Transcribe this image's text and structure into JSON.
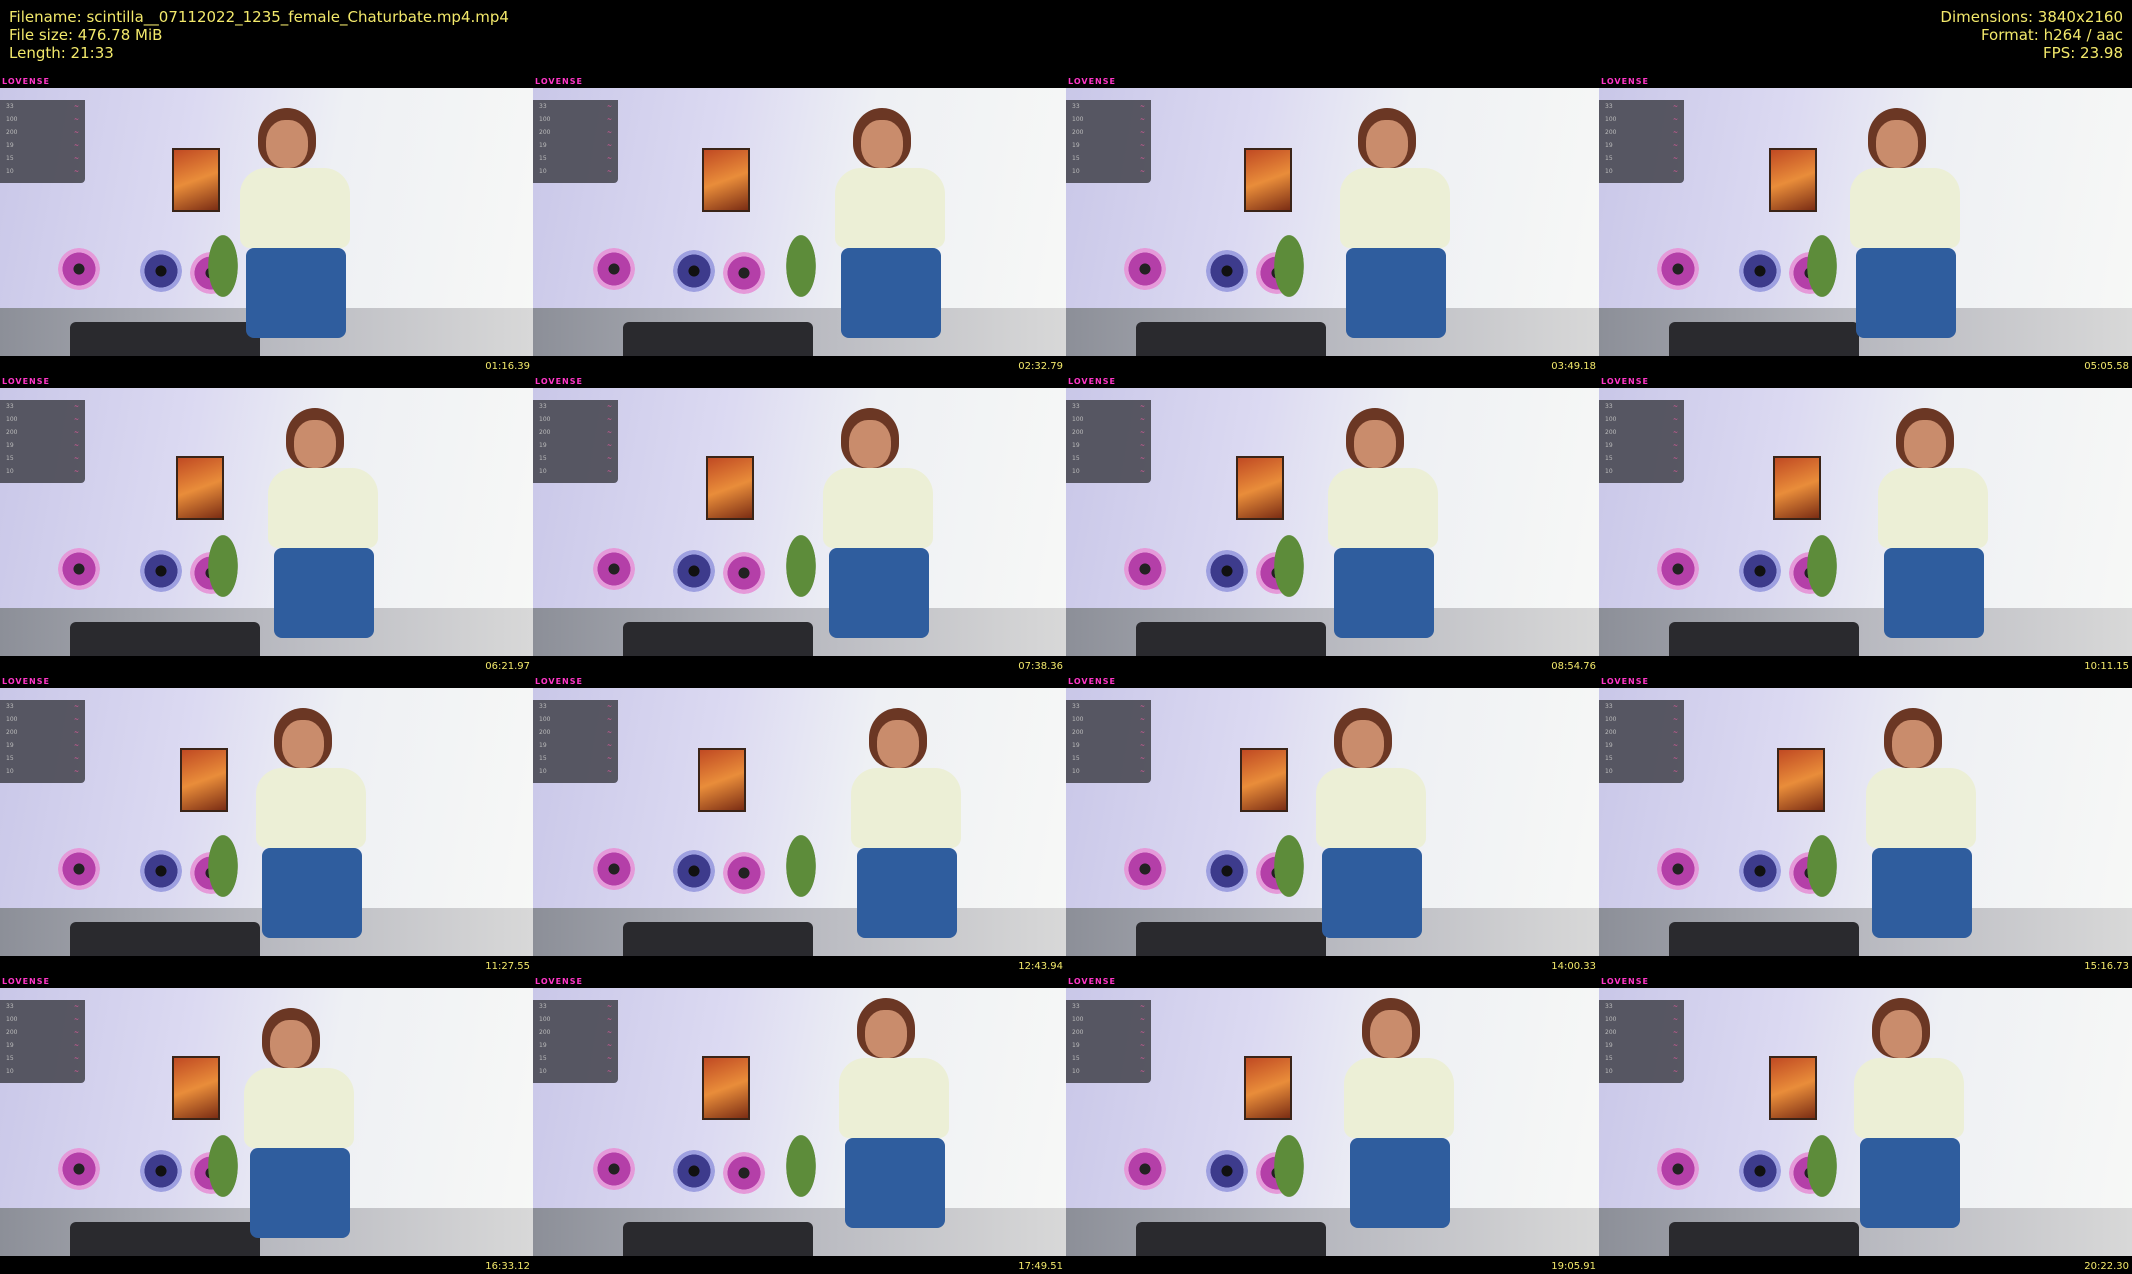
{
  "header": {
    "filename": "Filename: scintilla__07112022_1235_female_Chaturbate.mp4.mp4",
    "filesize": "File size: 476.78 MiB",
    "length": "Length: 21:33",
    "dimensions": "Dimensions: 3840x2160",
    "format": "Format: h264 / aac",
    "fps": "FPS: 23.98"
  },
  "overlay_label": "LOVENSE",
  "panel_rows": [
    "33",
    "100",
    "200",
    "19",
    "15",
    "10"
  ],
  "thumbnails": [
    {
      "timestamp": "01:16.39"
    },
    {
      "timestamp": "02:32.79"
    },
    {
      "timestamp": "03:49.18"
    },
    {
      "timestamp": "05:05.58"
    },
    {
      "timestamp": "06:21.97"
    },
    {
      "timestamp": "07:38.36"
    },
    {
      "timestamp": "08:54.76"
    },
    {
      "timestamp": "10:11.15"
    },
    {
      "timestamp": "11:27.55"
    },
    {
      "timestamp": "12:43.94"
    },
    {
      "timestamp": "14:00.33"
    },
    {
      "timestamp": "15:16.73"
    },
    {
      "timestamp": "16:33.12"
    },
    {
      "timestamp": "17:49.51"
    },
    {
      "timestamp": "19:05.91"
    },
    {
      "timestamp": "20:22.30"
    }
  ],
  "colors": {
    "text": "#f3e96b",
    "background": "#000000",
    "lovense": "#ff36c8"
  }
}
